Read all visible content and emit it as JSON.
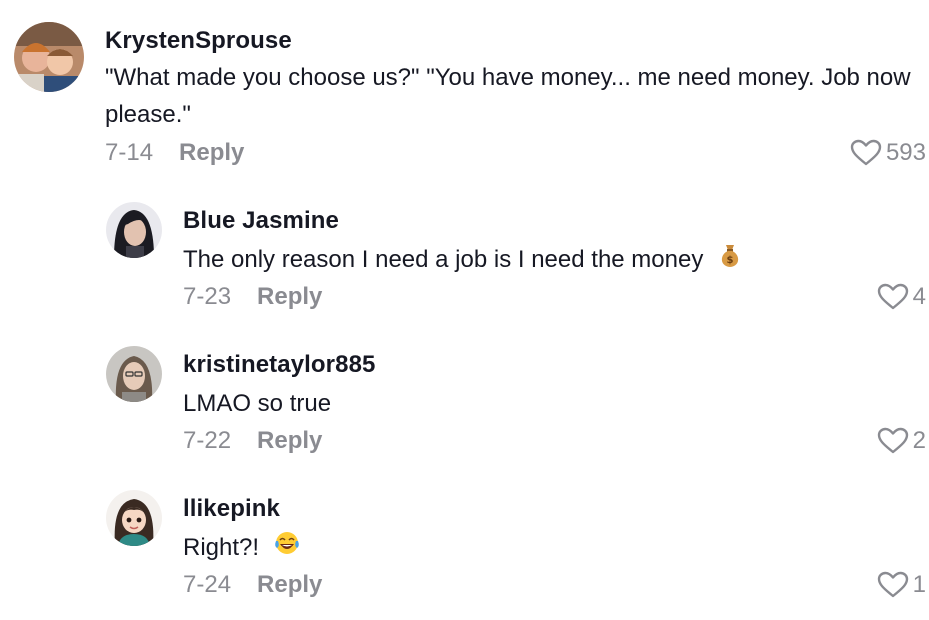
{
  "comments": [
    {
      "username": "KrystenSprouse",
      "text": "\"What made you choose us?\" \"You have money... me need money. Job now please.\"",
      "date": "7-14",
      "reply_label": "Reply",
      "likes": "593",
      "avatar_icon": "avatar-photo"
    },
    {
      "username": "Blue Jasmine",
      "text": "The only reason I need a job is I need the money",
      "emoji": "money-bag-emoji",
      "date": "7-23",
      "reply_label": "Reply",
      "likes": "4",
      "avatar_icon": "avatar-photo"
    },
    {
      "username": "kristinetaylor885",
      "text": "LMAO so true",
      "date": "7-22",
      "reply_label": "Reply",
      "likes": "2",
      "avatar_icon": "avatar-photo"
    },
    {
      "username": "llikepink",
      "text": "Right?!",
      "emoji": "tears-of-joy-emoji",
      "date": "7-24",
      "reply_label": "Reply",
      "likes": "1",
      "avatar_icon": "avatar-illustration"
    }
  ],
  "colors": {
    "text": "#161823",
    "muted": "#8a8b91",
    "background": "#ffffff"
  }
}
